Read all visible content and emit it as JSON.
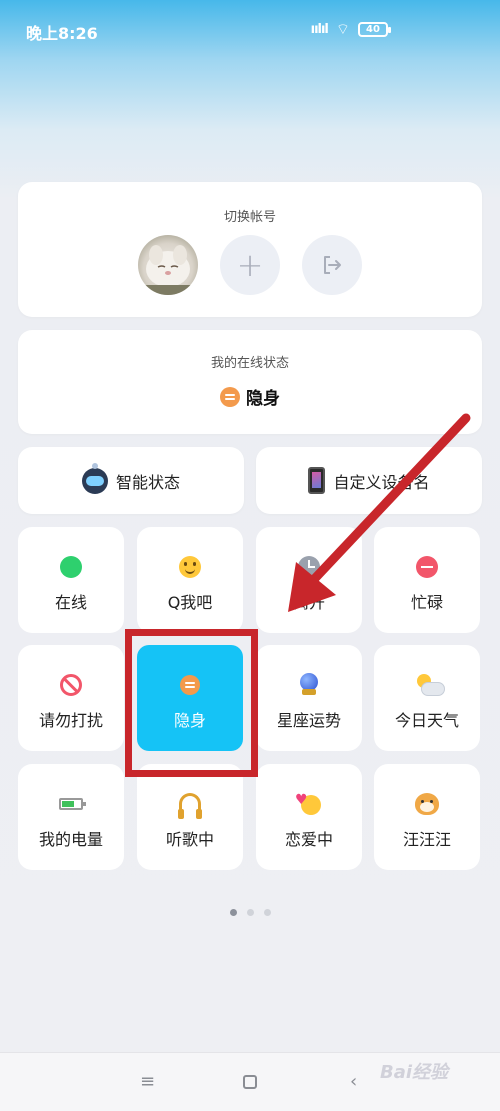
{
  "status_bar": {
    "time": "晚上8:26",
    "signal": "ıılıl",
    "wifi_glyph": "⌔",
    "battery": "40"
  },
  "account": {
    "title": "切换帐号",
    "add_glyph": "+",
    "logout_icon": "exit-icon"
  },
  "online_status": {
    "title": "我的在线状态",
    "value": "隐身"
  },
  "wide_cards": [
    {
      "label": "智能状态",
      "icon": "robot-icon"
    },
    {
      "label": "自定义设备名",
      "icon": "phone-icon"
    }
  ],
  "tiles": [
    {
      "label": "在线",
      "icon": "green-dot-icon"
    },
    {
      "label": "Q我吧",
      "icon": "smile-icon"
    },
    {
      "label": "离开",
      "icon": "clock-icon"
    },
    {
      "label": "忙碌",
      "icon": "minus-icon"
    },
    {
      "label": "请勿打扰",
      "icon": "no-entry-icon"
    },
    {
      "label": "隐身",
      "icon": "invisible-icon",
      "selected": true
    },
    {
      "label": "星座运势",
      "icon": "crystal-ball-icon"
    },
    {
      "label": "今日天气",
      "icon": "weather-icon"
    },
    {
      "label": "我的电量",
      "icon": "battery-icon"
    },
    {
      "label": "听歌中",
      "icon": "headphones-icon"
    },
    {
      "label": "恋爱中",
      "icon": "in-love-icon"
    },
    {
      "label": "汪汪汪",
      "icon": "dog-icon"
    }
  ],
  "pager": {
    "pages": 3,
    "active": 1
  },
  "nav": {
    "menu_glyph": "≡",
    "back_glyph": "‹"
  },
  "watermark": "Bai经验",
  "colors": {
    "selected_tile": "#15c3f6",
    "highlight": "#c8262b",
    "invisible": "#f39a4c"
  }
}
